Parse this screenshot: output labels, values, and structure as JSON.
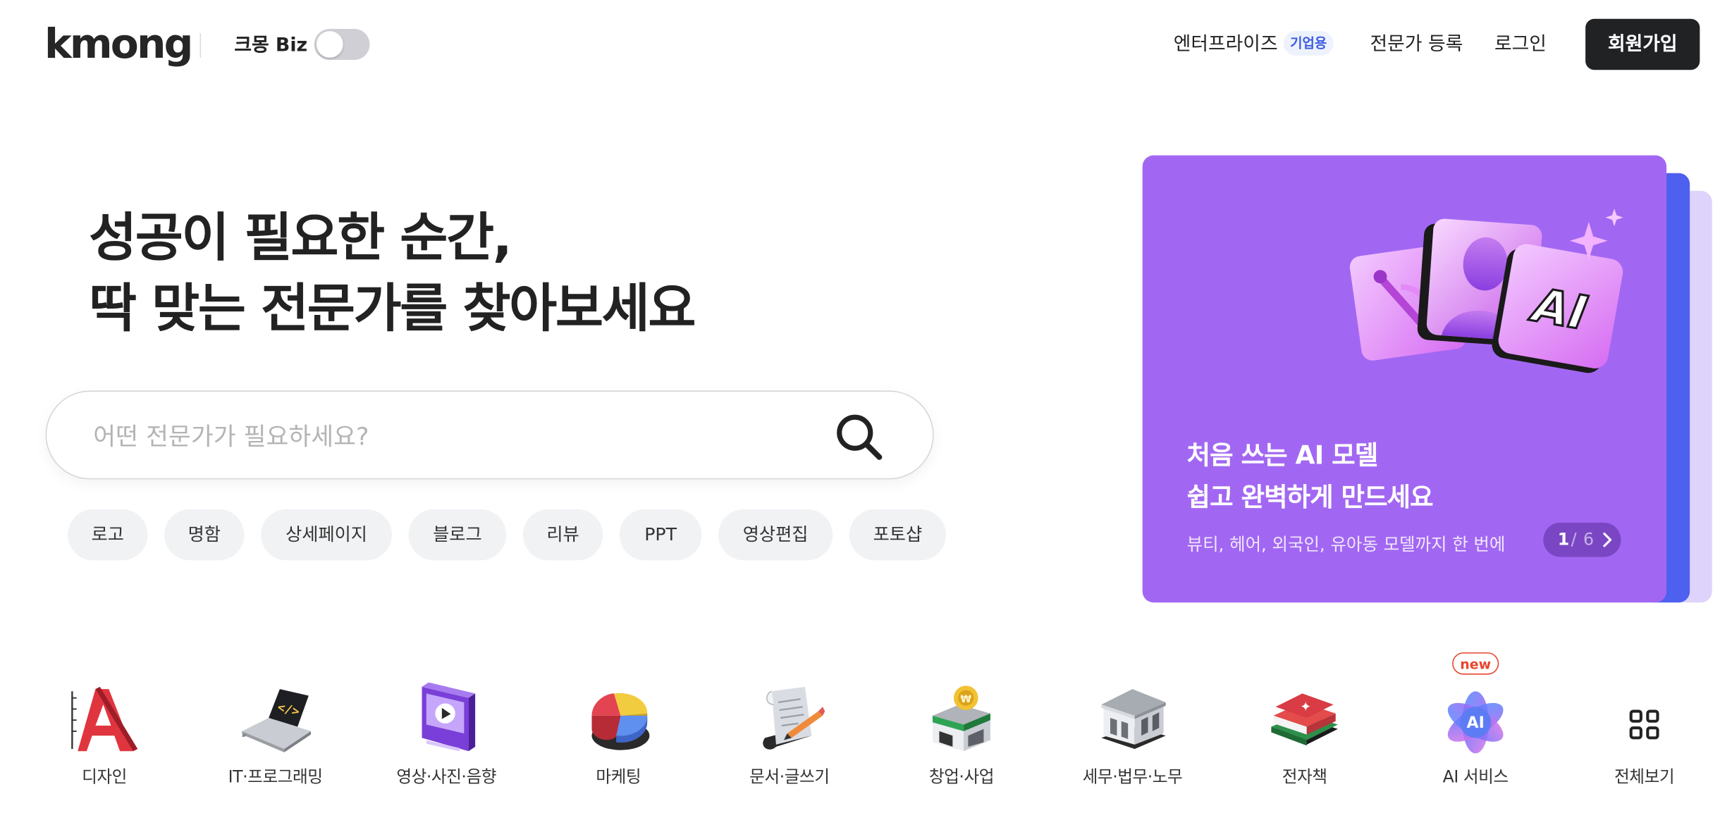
{
  "header": {
    "logo": "kmong",
    "biz_label": "크몽 Biz",
    "nav": {
      "enterprise": "엔터프라이즈",
      "enterprise_badge": "기업용",
      "register_expert": "전문가 등록",
      "login": "로그인",
      "signup": "회원가입"
    }
  },
  "hero": {
    "title_line1": "성공이 필요한 순간,",
    "title_line2": "딱 맞는 전문가를 찾아보세요",
    "search_placeholder": "어떤 전문가가 필요하세요?",
    "chips": [
      "로고",
      "명함",
      "상세페이지",
      "블로그",
      "리뷰",
      "PPT",
      "영상편집",
      "포토샵"
    ]
  },
  "banner": {
    "title_line1": "처음 쓰는 AI 모델",
    "title_line2": "쉽고 완벽하게 만드세요",
    "subtitle": "뷰티, 헤어, 외국인, 유아동 모델까지 한 번에",
    "pager_current": "1",
    "pager_separator": "/",
    "pager_total": "6",
    "art_text": "AI",
    "colors": {
      "main": "#a267f2",
      "back1": "#4d60ee",
      "back2": "#ded3fb"
    }
  },
  "categories": {
    "items": [
      {
        "label": "디자인",
        "icon": "design-letter-a-icon"
      },
      {
        "label": "IT·프로그래밍",
        "icon": "laptop-code-icon"
      },
      {
        "label": "영상·사진·음향",
        "icon": "video-player-icon"
      },
      {
        "label": "마케팅",
        "icon": "pie-chart-icon"
      },
      {
        "label": "문서·글쓰기",
        "icon": "document-pen-icon"
      },
      {
        "label": "창업·사업",
        "icon": "storefront-coin-icon"
      },
      {
        "label": "세무·법무·노무",
        "icon": "courthouse-icon"
      },
      {
        "label": "전자책",
        "icon": "books-icon"
      },
      {
        "label": "AI 서비스",
        "icon": "ai-flower-icon",
        "icon_text": "AI"
      },
      {
        "label": "전체보기",
        "icon": "grid-icon"
      }
    ],
    "new_badge": "new"
  }
}
